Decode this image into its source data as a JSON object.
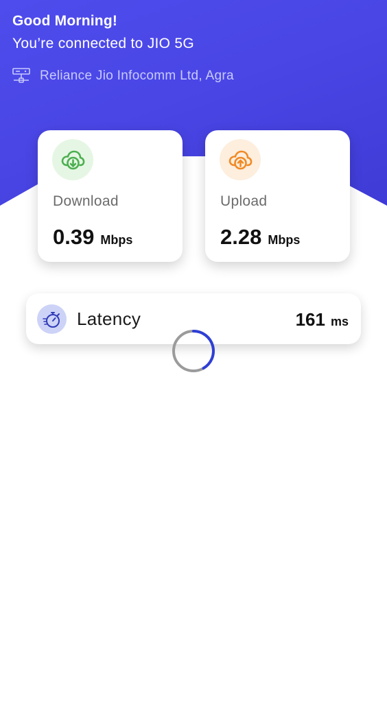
{
  "header": {
    "greeting": "Good Morning!",
    "connection": "You’re connected to JIO 5G",
    "provider": "Reliance Jio Infocomm Ltd, Agra",
    "provider_icon": "network-server-icon"
  },
  "download": {
    "label": "Download",
    "value": "0.39",
    "unit": "Mbps",
    "icon": "cloud-download-icon",
    "color": "#4caf50"
  },
  "upload": {
    "label": "Upload",
    "value": "2.28",
    "unit": "Mbps",
    "icon": "cloud-upload-icon",
    "color": "#f08a24"
  },
  "latency": {
    "label": "Latency",
    "value": "161",
    "unit": "ms",
    "icon": "stopwatch-icon"
  },
  "spinner": {
    "icon": "loading-spinner-icon",
    "color": "#2f3fd6"
  },
  "colors": {
    "header_bg": "#4a46e6",
    "provider_text": "#c9cbff"
  }
}
